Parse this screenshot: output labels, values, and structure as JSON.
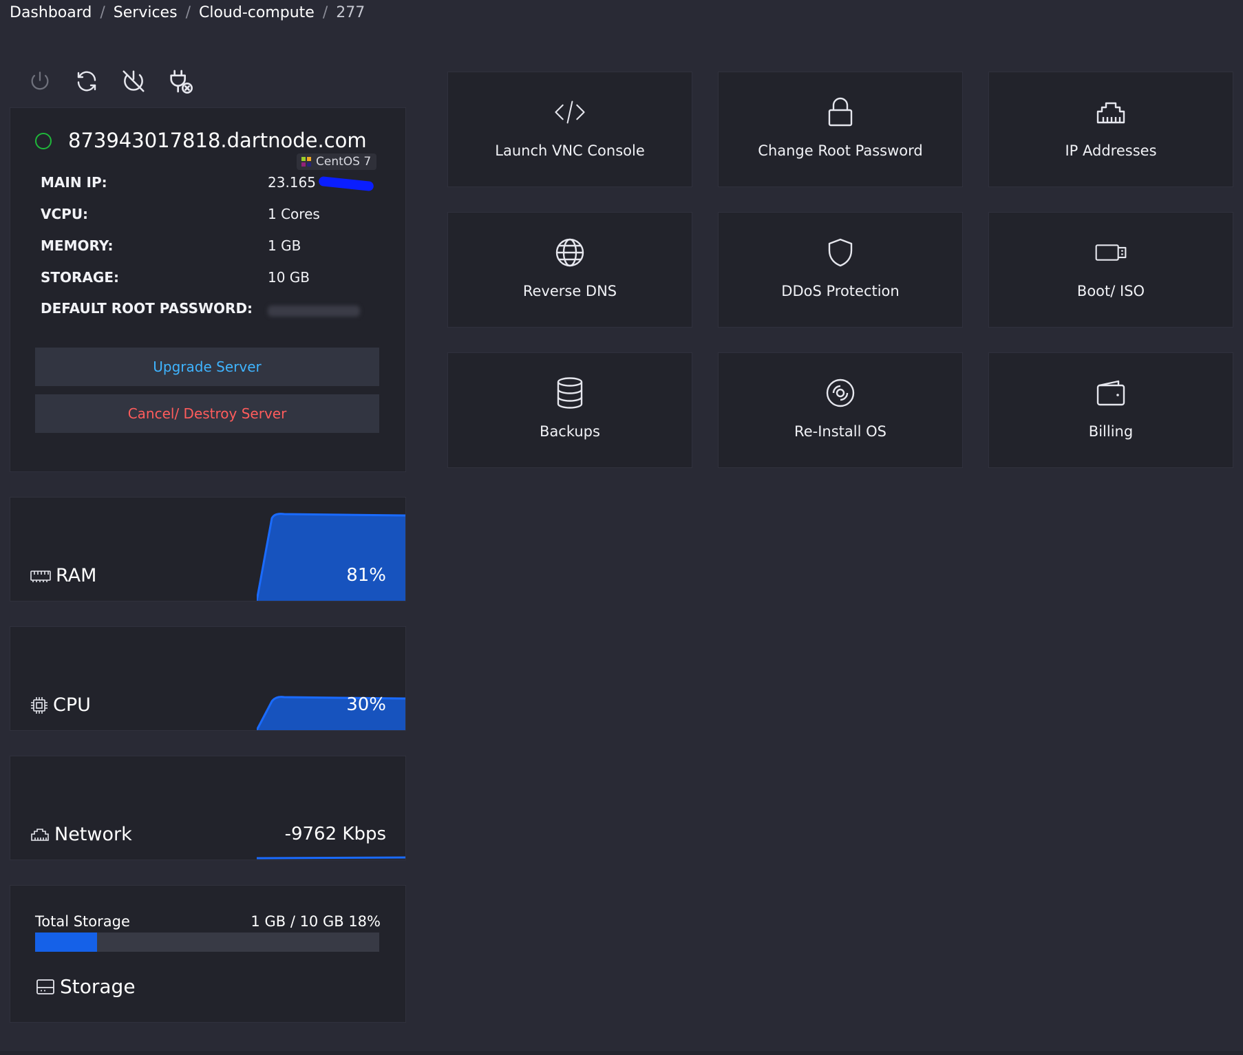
{
  "breadcrumb": {
    "items": [
      "Dashboard",
      "Services",
      "Cloud-compute"
    ],
    "current": "277",
    "separator": "/"
  },
  "toolbar": {
    "actions": [
      "power-icon",
      "restart-icon",
      "power-off-icon",
      "unplug-icon"
    ]
  },
  "server": {
    "hostname": "873943017818.dartnode.com",
    "status": "online",
    "status_color": "#1fb83a",
    "os": "CentOS 7",
    "specs": {
      "main_ip_label": "MAIN IP:",
      "main_ip_value": "23.165",
      "vcpu_label": "VCPU:",
      "vcpu_value": "1 Cores",
      "memory_label": "MEMORY:",
      "memory_value": "1 GB",
      "storage_label": "STORAGE:",
      "storage_value": "10 GB",
      "root_password_label": "DEFAULT ROOT PASSWORD:"
    },
    "upgrade_label": "Upgrade Server",
    "cancel_label": "Cancel/ Destroy Server"
  },
  "metrics": {
    "ram": {
      "label": "RAM",
      "value": "81%",
      "percent": 81
    },
    "cpu": {
      "label": "CPU",
      "value": "30%",
      "percent": 30
    },
    "network": {
      "label": "Network",
      "value": "-9762 Kbps"
    }
  },
  "storage": {
    "title": "Total Storage",
    "usage": "1 GB / 10 GB 18%",
    "percent": 18,
    "label": "Storage"
  },
  "tiles": [
    {
      "label": "Launch VNC Console",
      "icon": "code-icon"
    },
    {
      "label": "Change Root Password",
      "icon": "lock-icon"
    },
    {
      "label": "IP Addresses",
      "icon": "ethernet-icon"
    },
    {
      "label": "Reverse DNS",
      "icon": "globe-icon"
    },
    {
      "label": "DDoS Protection",
      "icon": "shield-icon"
    },
    {
      "label": "Boot/ ISO",
      "icon": "usb-drive-icon"
    },
    {
      "label": "Backups",
      "icon": "database-icon"
    },
    {
      "label": "Re-Install OS",
      "icon": "disc-icon"
    },
    {
      "label": "Billing",
      "icon": "wallet-icon"
    }
  ],
  "colors": {
    "background": "#292a35",
    "card": "#22232b",
    "accent_blue": "#1561e8",
    "upgrade_text": "#3fb4ff",
    "cancel_text": "#ff5c5c"
  }
}
